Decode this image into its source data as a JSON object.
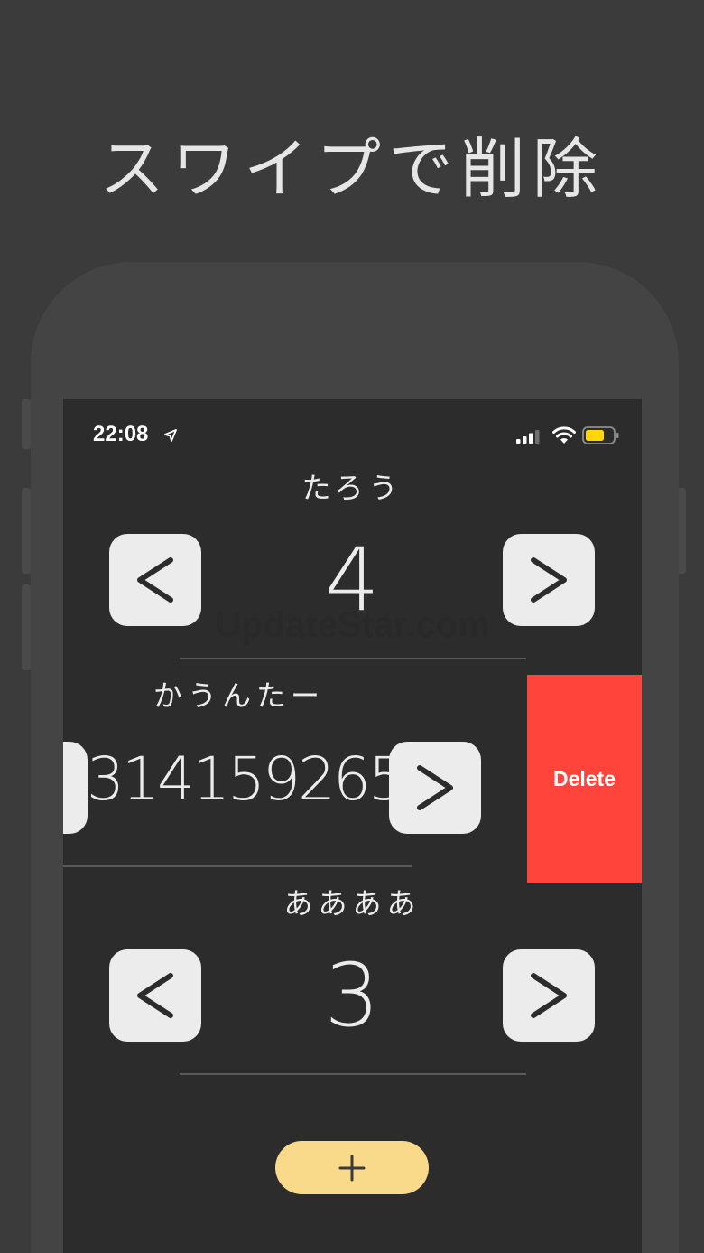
{
  "headline": "スワイプで削除",
  "status": {
    "time": "22:08"
  },
  "watermark": "UpdateStar.com",
  "counters": [
    {
      "name": "たろう",
      "value": "4"
    },
    {
      "name": "かうんたー",
      "value": "314159265"
    },
    {
      "name": "ああああ",
      "value": "3"
    }
  ],
  "swipe_action": {
    "label": "Delete"
  },
  "colors": {
    "background": "#3b3b3b",
    "screen": "#2c2c2c",
    "button": "#ececec",
    "delete": "#ff443b",
    "add_button": "#f9d98a",
    "battery": "#ffd60a"
  },
  "icons": {
    "decrement": "chevron-left-icon",
    "increment": "chevron-right-icon",
    "add": "plus-icon",
    "location": "location-arrow-icon",
    "signal": "cellular-signal-icon",
    "wifi": "wifi-icon",
    "battery": "battery-icon"
  }
}
